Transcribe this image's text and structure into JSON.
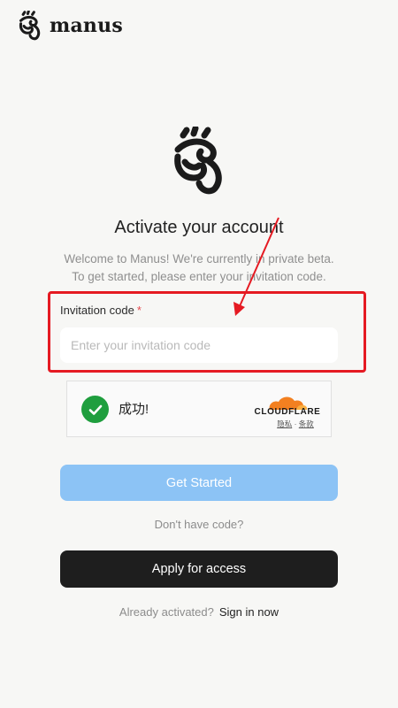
{
  "brand": {
    "name": "manus",
    "logo_icon": "manus-hand-logo-icon"
  },
  "main": {
    "title": "Activate your account",
    "subtitle_line1": "Welcome to Manus! We're currently in private beta.",
    "subtitle_line2": "To get started, please enter your invitation code."
  },
  "form": {
    "label": "Invitation code",
    "required_marker": "*",
    "input_placeholder": "Enter your invitation code",
    "input_value": ""
  },
  "captcha": {
    "status_text": "成功!",
    "status_icon": "checkmark-icon",
    "provider": "CLOUDFLARE",
    "privacy_link": "隐私",
    "separator": "·",
    "terms_link": "条款",
    "success_color": "#1f9e3e",
    "provider_color": "#f38020"
  },
  "actions": {
    "get_started_label": "Get Started",
    "no_code_text": "Don't have code?",
    "apply_label": "Apply for access",
    "already_activated_text": "Already activated?",
    "sign_in_label": "Sign in now"
  },
  "annotation": {
    "highlight_color": "#e51a22",
    "arrow_icon": "red-arrow-icon"
  },
  "colors": {
    "background": "#f7f7f5",
    "primary_button": "#8cc3f5",
    "dark_button": "#1e1e1e"
  }
}
